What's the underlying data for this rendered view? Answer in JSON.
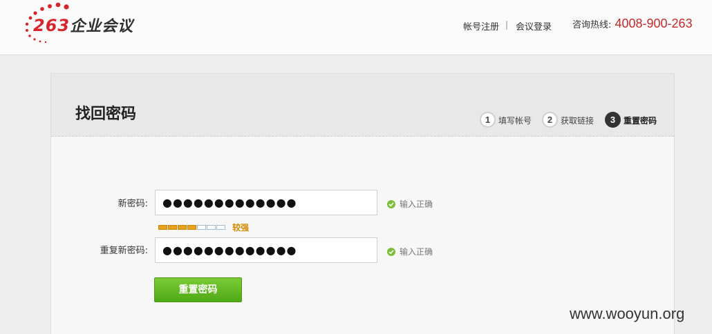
{
  "header": {
    "logo_number": "263",
    "logo_text": "企业会议",
    "nav_register": "帐号注册",
    "nav_separator": "|",
    "nav_login": "会议登录",
    "hotline_label": "咨询热线:",
    "hotline_number": "4008-900-263",
    "brand_color": "#d6262b"
  },
  "page": {
    "title": "找回密码",
    "steps": [
      {
        "num": "1",
        "label": "填写帐号",
        "active": false
      },
      {
        "num": "2",
        "label": "获取链接",
        "active": false
      },
      {
        "num": "3",
        "label": "重置密码",
        "active": true
      }
    ]
  },
  "form": {
    "new_password_label": "新密码:",
    "new_password_value": "●●●●●●●●●●●●●",
    "new_password_status": "输入正确",
    "strength_label": "较强",
    "strength_level": 0.57,
    "repeat_password_label": "重复新密码:",
    "repeat_password_value": "●●●●●●●●●●●●●",
    "repeat_password_status": "输入正确",
    "submit_label": "重置密码"
  },
  "watermark": "www.wooyun.org",
  "colors": {
    "accent_green": "#5cb51f",
    "strength_orange": "#e8a21a",
    "hotline_red": "#c52a2a"
  }
}
